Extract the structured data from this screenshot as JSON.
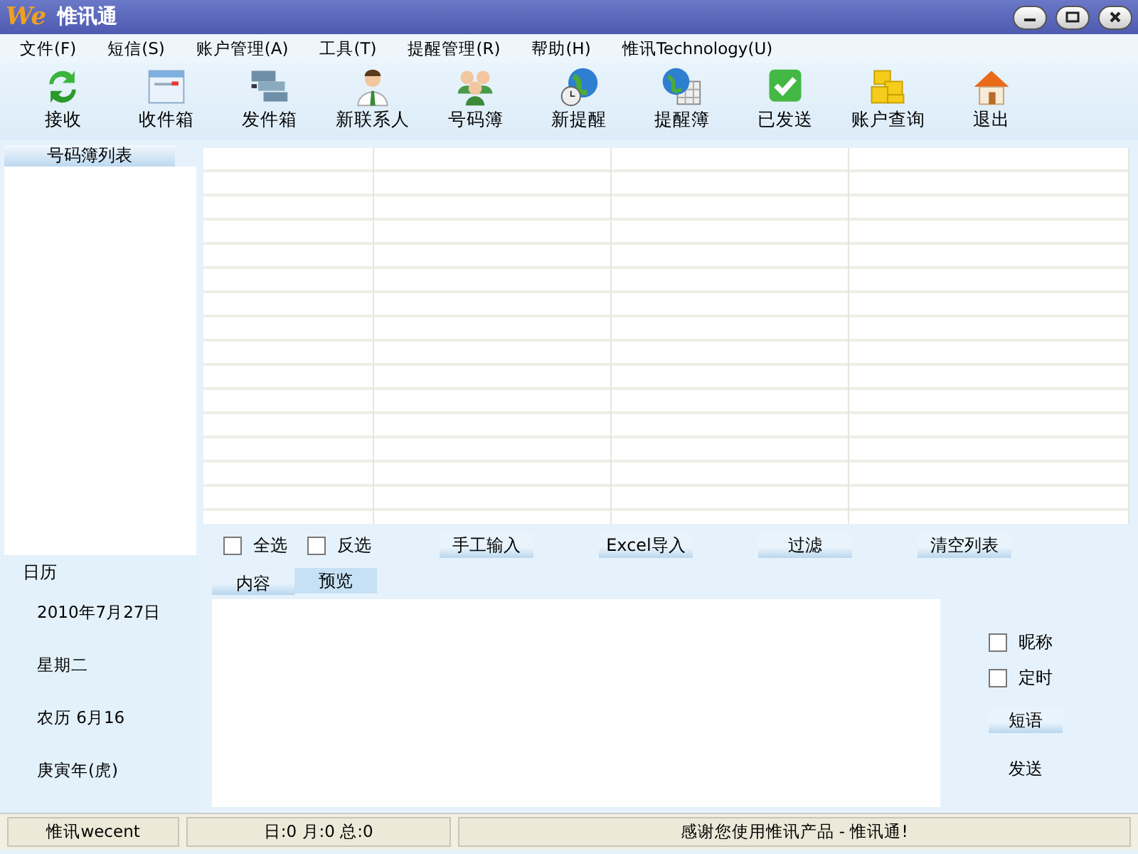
{
  "window": {
    "logo": "We",
    "title": "惟讯通"
  },
  "menu": [
    "文件(F)",
    "短信(S)",
    "账户管理(A)",
    "工具(T)",
    "提醒管理(R)",
    "帮助(H)",
    "惟讯Technology(U)"
  ],
  "toolbar": [
    {
      "label": "接收",
      "kind": "refresh"
    },
    {
      "label": "收件箱",
      "kind": "inbox"
    },
    {
      "label": "发件箱",
      "kind": "outbox"
    },
    {
      "label": "新联系人",
      "kind": "person"
    },
    {
      "label": "号码簿",
      "kind": "people"
    },
    {
      "label": "新提醒",
      "kind": "globeclock"
    },
    {
      "label": "提醒簿",
      "kind": "globegrid"
    },
    {
      "label": "已发送",
      "kind": "check"
    },
    {
      "label": "账户查询",
      "kind": "coins"
    },
    {
      "label": "退出",
      "kind": "house"
    }
  ],
  "phonebook": {
    "title": "号码簿列表"
  },
  "calendar": {
    "title": "日历",
    "date": "2010年7月27日",
    "weekday": "星期二",
    "lunar": "农历 6月16",
    "year": "庚寅年(虎)"
  },
  "list_controls": {
    "checkboxes": [
      {
        "label": "全选",
        "checked": false
      },
      {
        "label": "反选",
        "checked": false
      }
    ],
    "buttons": [
      "手工输入",
      "Excel导入",
      "过滤",
      "清空列表"
    ]
  },
  "tabs": [
    {
      "label": "内容",
      "selected": false
    },
    {
      "label": "预览",
      "selected": true
    }
  ],
  "options": [
    {
      "label": "昵称",
      "checked": false
    },
    {
      "label": "定时",
      "checked": false
    }
  ],
  "side_buttons": [
    "短语",
    "发送"
  ],
  "status_bar": [
    "惟讯wecent",
    "日:0 月:0 总:0",
    "感谢您使用惟讯产品 - 惟讯通!"
  ]
}
